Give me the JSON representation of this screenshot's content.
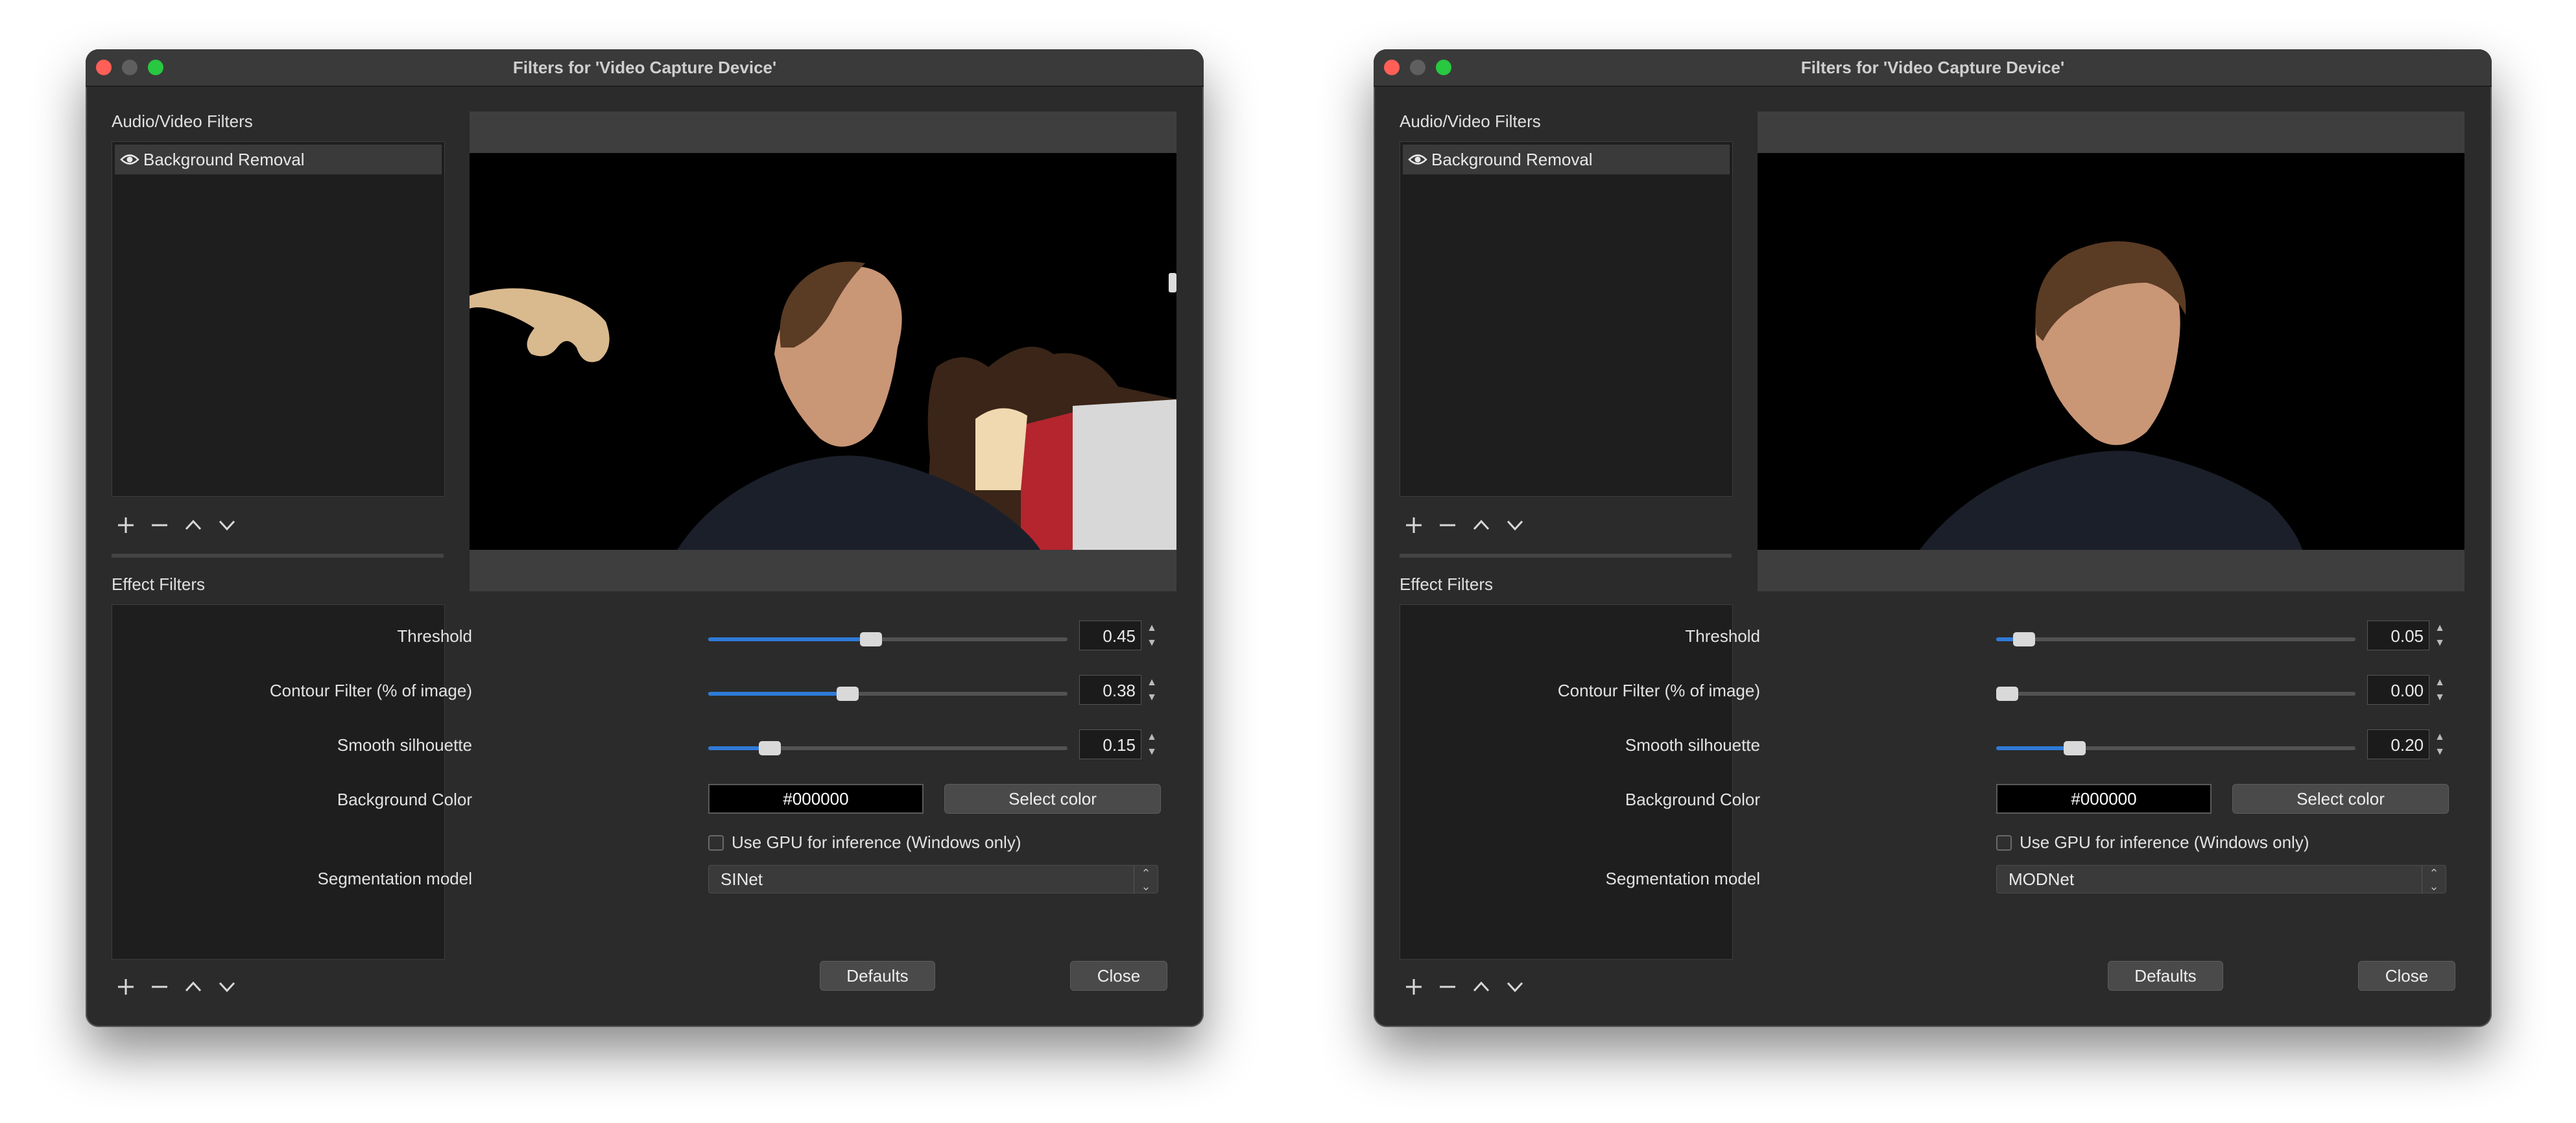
{
  "windows": [
    {
      "title": "Filters for 'Video Capture Device'",
      "audio_video_label": "Audio/Video Filters",
      "filter_item": "Background Removal",
      "effect_label": "Effect Filters",
      "threshold_label": "Threshold",
      "threshold_value": "0.45",
      "threshold_level": 0.45,
      "contour_label": "Contour Filter (% of image)",
      "contour_value": "0.38",
      "contour_level": 0.38,
      "smooth_label": "Smooth silhouette",
      "smooth_value": "0.15",
      "smooth_level": 0.15,
      "bgcolor_label": "Background Color",
      "bgcolor_value": "#000000",
      "select_color": "Select color",
      "gpu_label": "Use GPU for inference (Windows only)",
      "gpu_checked": false,
      "seg_label": "Segmentation model",
      "seg_value": "SINet",
      "defaults": "Defaults",
      "close": "Close"
    },
    {
      "title": "Filters for 'Video Capture Device'",
      "audio_video_label": "Audio/Video Filters",
      "filter_item": "Background Removal",
      "effect_label": "Effect Filters",
      "threshold_label": "Threshold",
      "threshold_value": "0.05",
      "threshold_level": 0.05,
      "contour_label": "Contour Filter (% of image)",
      "contour_value": "0.00",
      "contour_level": 0.0,
      "smooth_label": "Smooth silhouette",
      "smooth_value": "0.20",
      "smooth_level": 0.2,
      "bgcolor_label": "Background Color",
      "bgcolor_value": "#000000",
      "select_color": "Select color",
      "gpu_label": "Use GPU for inference (Windows only)",
      "gpu_checked": false,
      "seg_label": "Segmentation model",
      "seg_value": "MODNet",
      "defaults": "Defaults",
      "close": "Close"
    }
  ],
  "colors": {
    "accent": "#2f7bd8",
    "window_bg": "#2b2b2b",
    "close_light": "#ff5f57",
    "zoom_light": "#28c840"
  }
}
